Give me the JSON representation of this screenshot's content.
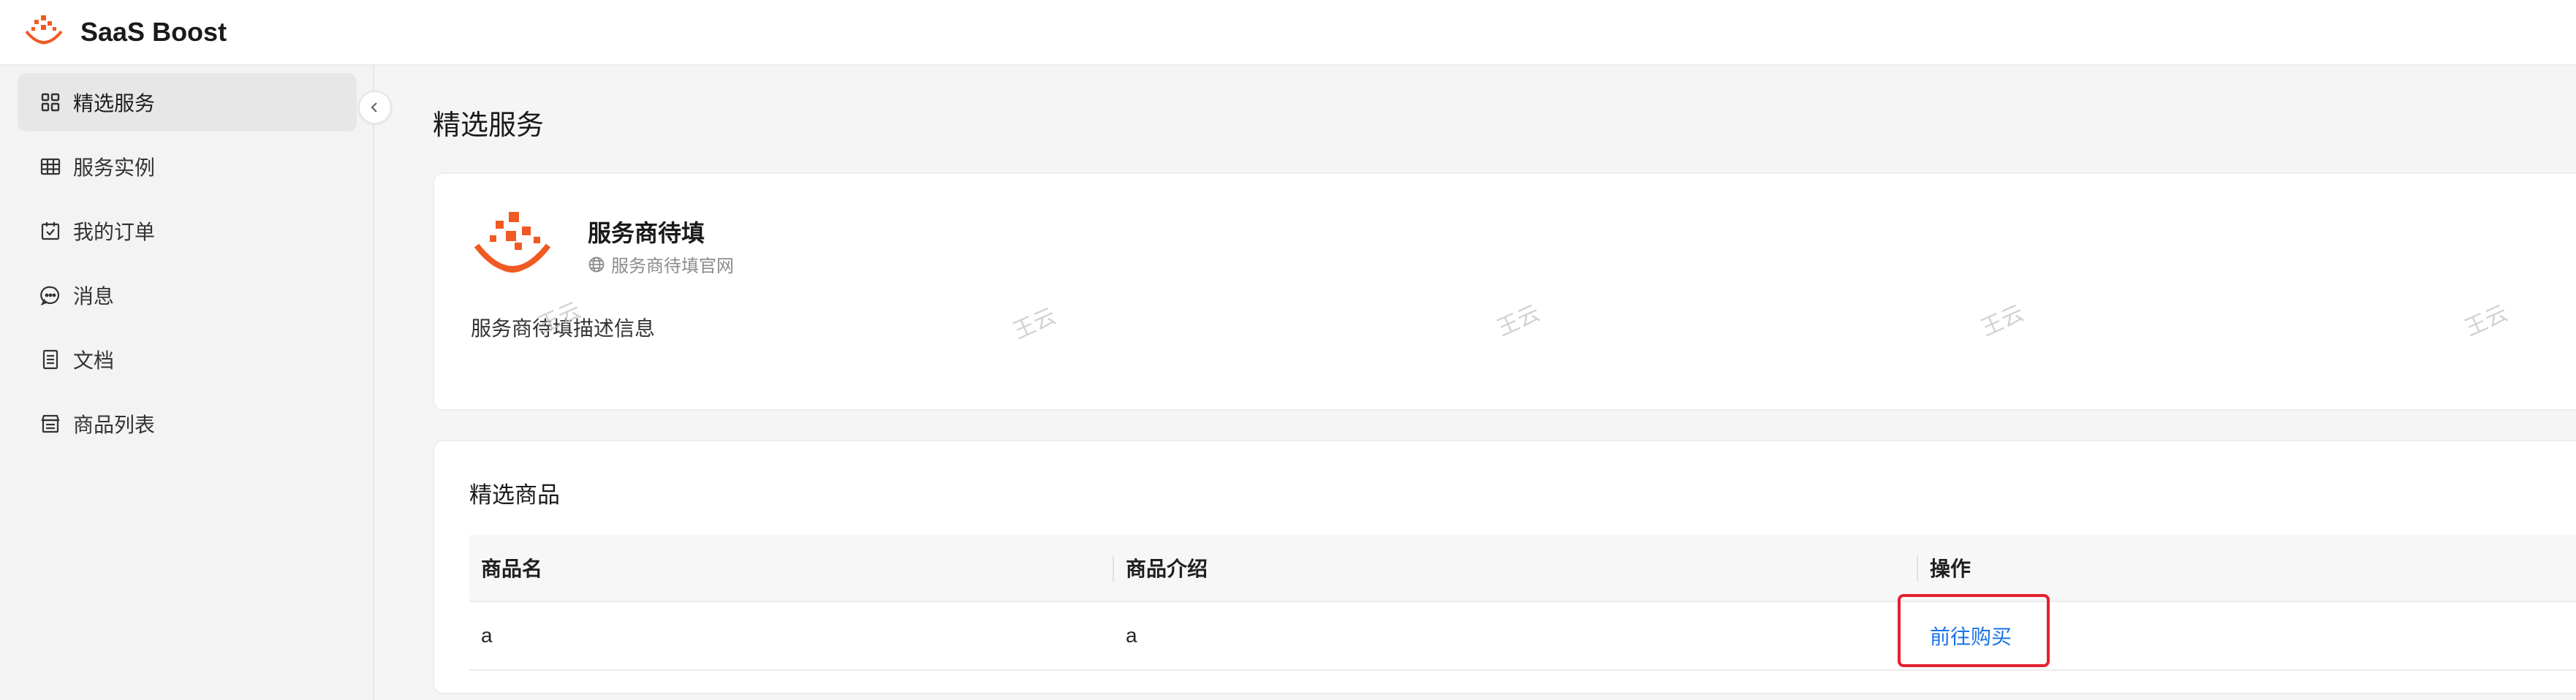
{
  "app": {
    "title": "SaaS Boost"
  },
  "sidebar": {
    "items": [
      {
        "label": "精选服务",
        "icon": "grid-apps-icon",
        "active": true
      },
      {
        "label": "服务实例",
        "icon": "table-icon",
        "active": false
      },
      {
        "label": "我的订单",
        "icon": "calendar-order-icon",
        "active": false
      },
      {
        "label": "消息",
        "icon": "chat-bubble-icon",
        "active": false
      },
      {
        "label": "文档",
        "icon": "document-icon",
        "active": false
      },
      {
        "label": "商品列表",
        "icon": "store-list-icon",
        "active": false
      }
    ]
  },
  "page": {
    "title": "精选服务"
  },
  "provider": {
    "name": "服务商待填",
    "website": "服务商待填官网",
    "description": "服务商待填描述信息"
  },
  "products": {
    "title": "精选商品",
    "columns": [
      "商品名",
      "商品介绍",
      "操作"
    ],
    "rows": [
      {
        "name": "a",
        "intro": "a",
        "action": "前往购买"
      }
    ]
  },
  "watermark": {
    "text": "王云"
  },
  "colors": {
    "brand": "#f05a22",
    "link": "#1a73e8",
    "highlight": "#e5202f"
  }
}
